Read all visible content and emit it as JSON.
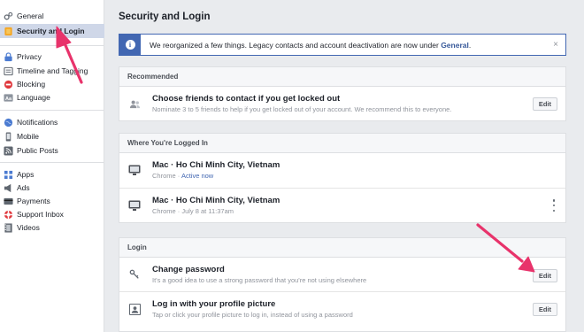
{
  "sidebar": {
    "items": [
      {
        "label": "General",
        "icon": "gear-icon"
      },
      {
        "label": "Security and Login",
        "icon": "shield-icon",
        "active": true
      },
      {
        "label": "Privacy",
        "icon": "lock-icon"
      },
      {
        "label": "Timeline and Tagging",
        "icon": "timeline-icon"
      },
      {
        "label": "Blocking",
        "icon": "blocking-icon"
      },
      {
        "label": "Language",
        "icon": "language-icon"
      },
      {
        "label": "Notifications",
        "icon": "globe-icon"
      },
      {
        "label": "Mobile",
        "icon": "mobile-icon"
      },
      {
        "label": "Public Posts",
        "icon": "rss-icon"
      },
      {
        "label": "Apps",
        "icon": "apps-icon"
      },
      {
        "label": "Ads",
        "icon": "ads-icon"
      },
      {
        "label": "Payments",
        "icon": "credit-card-icon"
      },
      {
        "label": "Support Inbox",
        "icon": "lifebuoy-icon"
      },
      {
        "label": "Videos",
        "icon": "film-icon"
      }
    ]
  },
  "main": {
    "title": "Security and Login",
    "notice": {
      "text": "We reorganized a few things. Legacy contacts and account deactivation are now under ",
      "link": "General",
      "end": ".",
      "close": "×"
    },
    "recommended": {
      "header": "Recommended",
      "title": "Choose friends to contact if you get locked out",
      "sub": "Nominate 3 to 5 friends to help if you get locked out of your account. We recommend this to everyone.",
      "button": "Edit"
    },
    "logged_in": {
      "header": "Where You're Logged In",
      "sessions": [
        {
          "title": "Mac · Ho Chi Minh City, Vietnam",
          "sub_prefix": "Chrome · ",
          "sub_status": "Active now"
        },
        {
          "title": "Mac · Ho Chi Minh City, Vietnam",
          "sub_prefix": "Chrome · July 8 at 11:37am",
          "sub_status": ""
        }
      ]
    },
    "login": {
      "header": "Login",
      "change_password": {
        "title": "Change password",
        "sub": "It's a good idea to use a strong password that you're not using elsewhere",
        "button": "Edit"
      },
      "profile_picture": {
        "title": "Log in with your profile picture",
        "sub": "Tap or click your profile picture to log in, instead of using a password",
        "button": "Edit"
      }
    }
  },
  "colors": {
    "accent": "#4267b2",
    "annotation_arrow": "#e8336b",
    "active_bg": "#cfd7e8"
  }
}
